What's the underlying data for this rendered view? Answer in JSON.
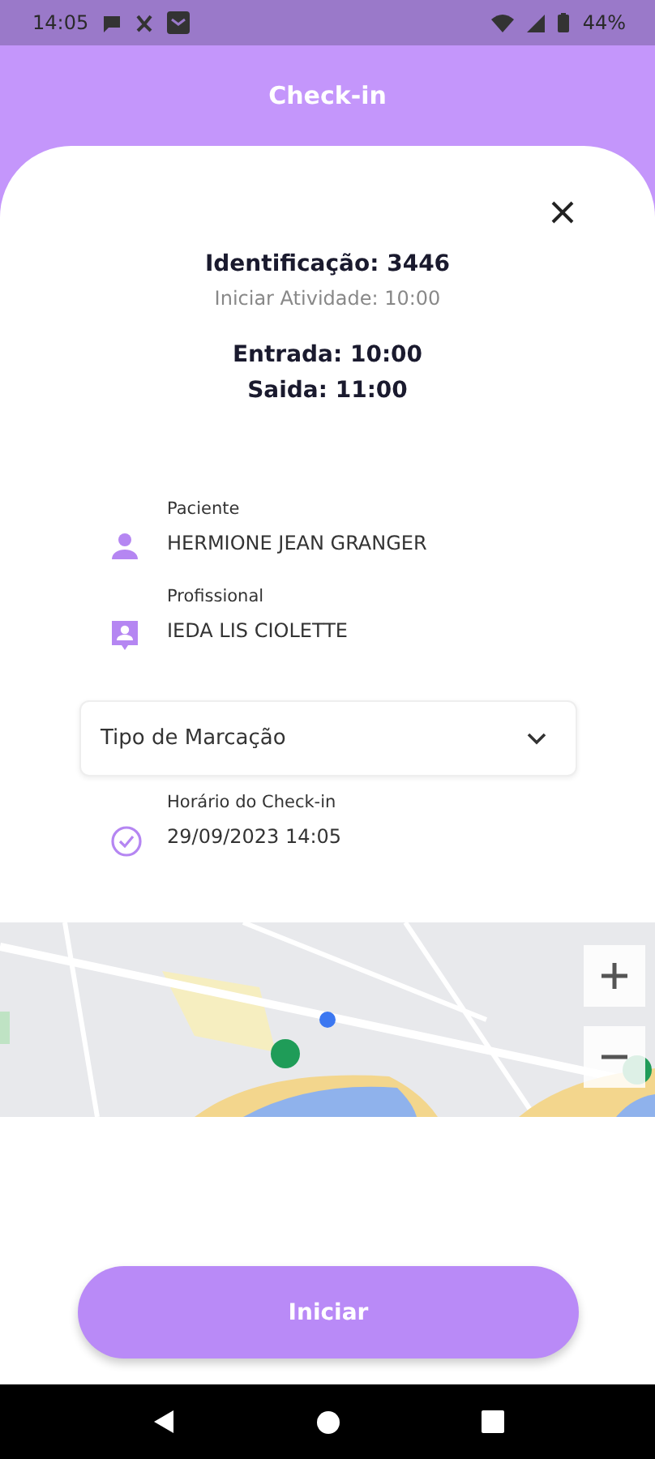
{
  "status_bar": {
    "time": "14:05",
    "battery": "44%"
  },
  "header": {
    "title": "Check-in"
  },
  "summary": {
    "identification": "Identificação: 3446",
    "start_activity": "Iniciar Atividade: 10:00",
    "entry": "Entrada: 10:00",
    "exit": "Saida: 11:00"
  },
  "fields": [
    {
      "kind": "person",
      "label": "Paciente",
      "value": "HERMIONE JEAN GRANGER"
    },
    {
      "kind": "badge",
      "label": "Profissional",
      "value": "IEDA LIS CIOLETTE"
    }
  ],
  "dropdown": {
    "placeholder": "Tipo  de Marcação"
  },
  "checkin": {
    "label": "Horário do Check-in",
    "value": "29/09/2023 14:05"
  },
  "button": {
    "label": "Iniciar"
  }
}
